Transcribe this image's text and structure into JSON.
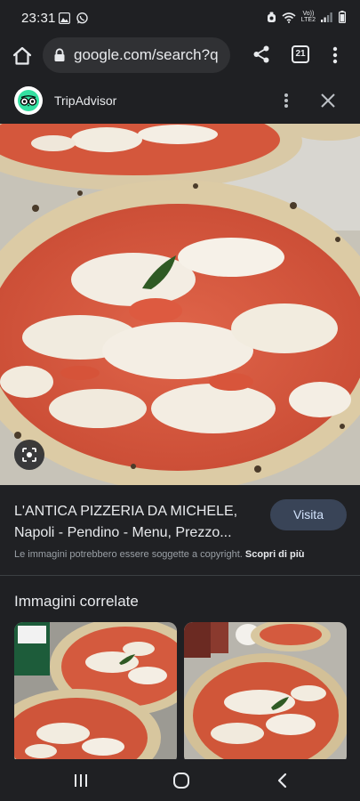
{
  "status_bar": {
    "time": "23:31",
    "volte_top": "Vo))",
    "volte_bottom": "LTE2"
  },
  "browser": {
    "url": "google.com/search?q",
    "tab_count": "21"
  },
  "source": {
    "name": "TripAdvisor",
    "logo_icon": "tripadvisor-owl-icon",
    "brand_color": "#34e0a1"
  },
  "result": {
    "title": "L'ANTICA PIZZERIA DA MICHELE, Napoli - Pendino - Menu, Prezzo...",
    "visit_label": "Visita",
    "copyright_note": "Le immagini potrebbero essere soggette a copyright.",
    "learn_more": "Scopri di più"
  },
  "related": {
    "title": "Immagini correlate"
  },
  "colors": {
    "background": "#1f2023",
    "visit_button": "#394457",
    "visit_text": "#d2e3fc"
  }
}
